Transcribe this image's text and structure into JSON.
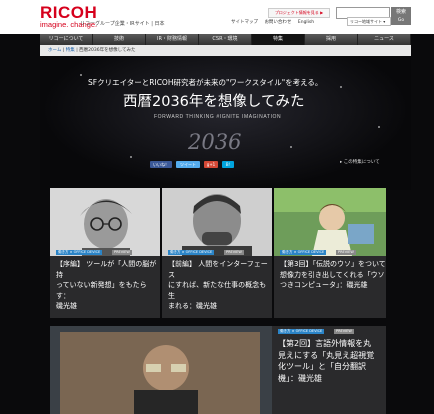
{
  "header": {
    "logo": "RICOH",
    "tagline": "imagine. change.",
    "group_site": "リコーグループ企業・IRサイト | 日本",
    "pr_button": "プロジェクト情報を見る ▶",
    "search_button": "検索",
    "utility_links": [
      "サイトマップ",
      "お問い合わせ",
      "English"
    ],
    "lang_select": "リコー地域サイト ▾",
    "go_button": "Go"
  },
  "nav": {
    "items": [
      "リコーについて",
      "技術",
      "IR・財務情報",
      "CSR・環境",
      "特集",
      "採用",
      "ニュース"
    ],
    "active_index": 4
  },
  "breadcrumb": {
    "home": "ホーム",
    "section": "特集",
    "current": "西暦2036年を想像してみた"
  },
  "hero": {
    "headline": "SFクリエイターとRICOH研究者が未来の\"ワークスタイル\"を考える。",
    "title": "西暦2036年を想像してみた",
    "subtitle": "FORWARD THINKING #IGNITE IMAGINATION",
    "year": "2036",
    "social": {
      "like": "いいね！",
      "tweet": "ツイート",
      "gplus": "g+1",
      "bookmark": "B!"
    },
    "about_link": "この特集について"
  },
  "articles": [
    {
      "category": "働き方 × OFFICE DEVICE",
      "status": "PREVIEW",
      "title_lines": [
        "【序編】 ツールが「人間の脳が持",
        "っていない新発想」をもたらす：",
        "磯光雄"
      ]
    },
    {
      "category": "働き方 × OFFICE DEVICE",
      "status": "PREVIEW",
      "title_lines": [
        "【前編】 人間をインターフェース",
        "にすれば、新たな仕事の概念も生",
        "まれる：磯光雄"
      ]
    },
    {
      "category": "働き方 × OFFICE DEVICE",
      "status": "PREVIEW",
      "title_lines": [
        "【第3回】「伝説のウソ」をついて",
        "想像力を引き出してくれる「ウソ",
        "つきコンピュータ」：磯光雄"
      ]
    },
    {
      "category": "働き方 × OFFICE DEVICE",
      "status": "PREVIEW",
      "title_lines": [
        "【第2回】言語外情報を丸",
        "見えにする「丸見え超視覚",
        "化ツール」と「自分翻訳",
        "機」：磯光雄"
      ]
    }
  ],
  "colors": {
    "brand_red": "#d6001c",
    "category_blue": "#2b84c7",
    "facebook": "#3b5998",
    "twitter": "#55acee",
    "gplus": "#d34836",
    "hatena": "#00a4de"
  }
}
